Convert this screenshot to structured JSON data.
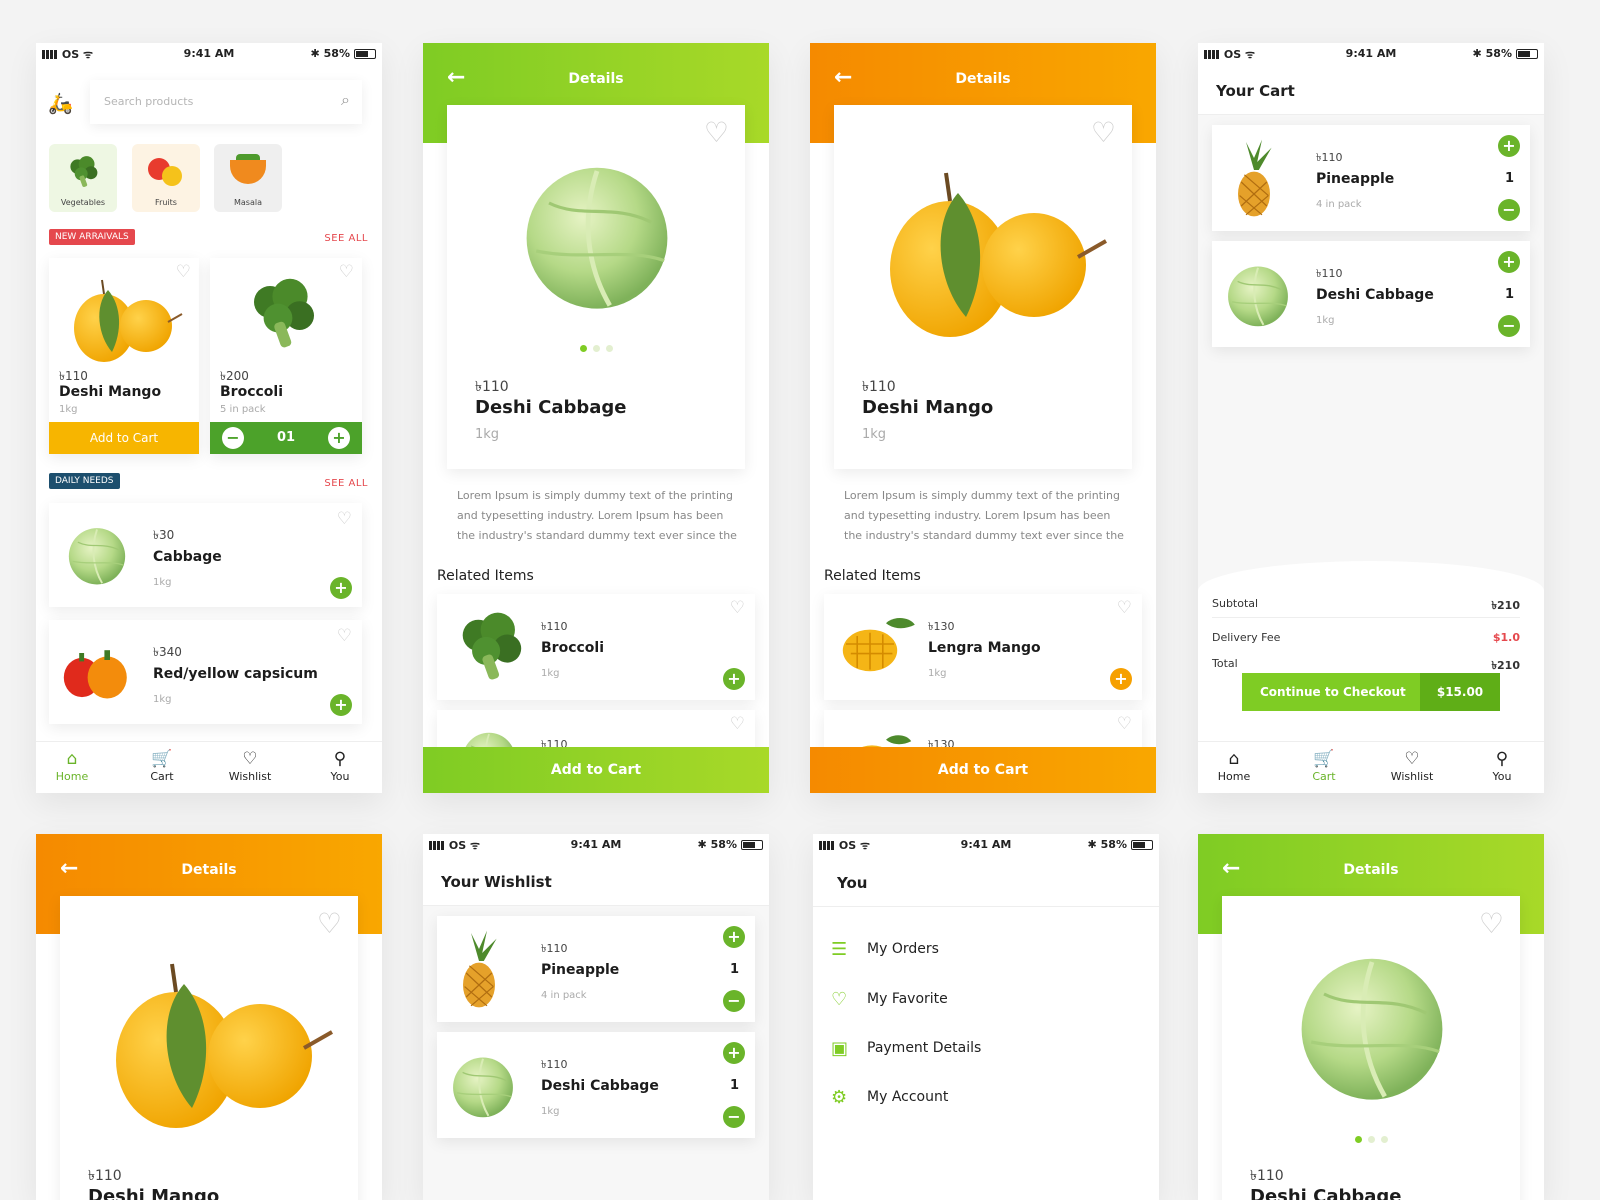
{
  "status": {
    "carrier": "OS",
    "time": "9:41 AM",
    "battery": "58%"
  },
  "home": {
    "search_placeholder": "Search products",
    "categories": [
      {
        "label": "Vegetables",
        "icon": "broccoli-icon"
      },
      {
        "label": "Fruits",
        "icon": "fruits-icon"
      },
      {
        "label": "Masala",
        "icon": "masala-bowl-icon"
      }
    ],
    "new_arrivals_label": "NEW ARRAIVALS",
    "daily_needs_label": "DAILY NEEDS",
    "see_all": "SEE ALL",
    "arrivals": [
      {
        "price": "৳110",
        "name": "Deshi Mango",
        "unit": "1kg",
        "cta": "Add to Cart"
      },
      {
        "price": "৳200",
        "name": "Broccoli",
        "unit": "5 in pack",
        "qty": "01"
      }
    ],
    "daily": [
      {
        "price": "৳30",
        "name": "Cabbage",
        "unit": "1kg"
      },
      {
        "price": "৳340",
        "name": "Red/yellow capsicum",
        "unit": "1kg"
      }
    ]
  },
  "nav": {
    "home": "Home",
    "cart": "Cart",
    "wishlist": "Wishlist",
    "you": "You"
  },
  "details_title": "Details",
  "add_to_cart": "Add to Cart",
  "related_items": "Related Items",
  "lorem": "Lorem Ipsum is simply dummy text of the printing and typesetting industry. Lorem Ipsum has been the industry's standard dummy text ever since the",
  "detail_cabbage": {
    "price": "৳110",
    "name": "Deshi Cabbage",
    "unit": "1kg",
    "related": [
      {
        "price": "৳110",
        "name": "Broccoli",
        "unit": "1kg"
      },
      {
        "price": "৳110"
      }
    ]
  },
  "detail_mango": {
    "price": "৳110",
    "name": "Deshi Mango",
    "unit": "1kg",
    "related": [
      {
        "price": "৳130",
        "name": "Lengra Mango",
        "unit": "1kg"
      },
      {
        "price": "৳130"
      }
    ]
  },
  "cart": {
    "title": "Your Cart",
    "items": [
      {
        "price": "৳110",
        "name": "Pineapple",
        "unit": "4 in pack",
        "qty": "1"
      },
      {
        "price": "৳110",
        "name": "Deshi Cabbage",
        "unit": "1kg",
        "qty": "1"
      }
    ],
    "subtotal_label": "Subtotal",
    "subtotal": "৳210",
    "delivery_label": "Delivery Fee",
    "delivery": "$1.0",
    "total_label": "Total",
    "total": "৳210",
    "checkout": "Continue to Checkout",
    "checkout_amount": "$15.00"
  },
  "wishlist": {
    "title": "Your Wishlist",
    "items": [
      {
        "price": "৳110",
        "name": "Pineapple",
        "unit": "4 in pack",
        "qty": "1"
      },
      {
        "price": "৳110",
        "name": "Deshi Cabbage",
        "unit": "1kg",
        "qty": "1"
      }
    ]
  },
  "you": {
    "title": "You",
    "menu": [
      {
        "label": "My Orders",
        "icon": "orders-icon"
      },
      {
        "label": "My Favorite",
        "icon": "heart-icon"
      },
      {
        "label": "Payment Details",
        "icon": "wallet-icon"
      },
      {
        "label": "My Account",
        "icon": "gear-icon"
      }
    ]
  },
  "bottom_mango": {
    "price": "৳110",
    "name": "Deshi Mango"
  },
  "bottom_cabbage": {
    "price": "৳110",
    "name": "Deshi Cabbage"
  },
  "colors": {
    "green": "#7fcc24",
    "orange": "#f58a00",
    "red": "#e5484d",
    "navy": "#1d4f6e"
  }
}
